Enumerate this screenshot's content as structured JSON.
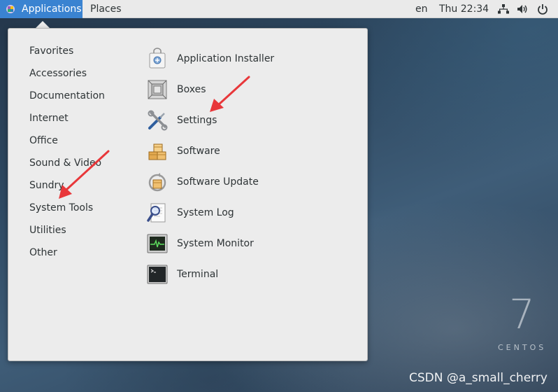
{
  "top_bar": {
    "applications_label": "Applications",
    "places_label": "Places",
    "language": "en",
    "clock": "Thu 22:34",
    "icons": [
      "network-icon",
      "volume-icon",
      "power-icon"
    ]
  },
  "menu": {
    "categories": [
      {
        "label": "Favorites"
      },
      {
        "label": "Accessories"
      },
      {
        "label": "Documentation"
      },
      {
        "label": "Internet"
      },
      {
        "label": "Office"
      },
      {
        "label": "Sound & Video"
      },
      {
        "label": "Sundry"
      },
      {
        "label": "System Tools"
      },
      {
        "label": "Utilities"
      },
      {
        "label": "Other"
      }
    ],
    "apps": [
      {
        "label": "Application Installer",
        "icon": "app-installer-icon"
      },
      {
        "label": "Boxes",
        "icon": "boxes-icon"
      },
      {
        "label": "Settings",
        "icon": "settings-icon"
      },
      {
        "label": "Software",
        "icon": "software-icon"
      },
      {
        "label": "Software Update",
        "icon": "software-update-icon"
      },
      {
        "label": "System Log",
        "icon": "system-log-icon"
      },
      {
        "label": "System Monitor",
        "icon": "system-monitor-icon"
      },
      {
        "label": "Terminal",
        "icon": "terminal-icon"
      }
    ]
  },
  "desktop": {
    "centos_number": "7",
    "centos_word": "CENTOS",
    "watermark": "CSDN @a_small_cherry"
  },
  "colors": {
    "accent": "#3a83d1",
    "annotation_arrow": "#e8373a",
    "menu_bg": "#ececec"
  }
}
